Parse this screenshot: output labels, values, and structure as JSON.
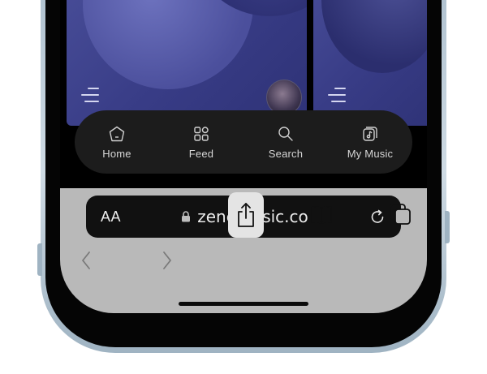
{
  "nav": {
    "items": [
      {
        "label": "Home",
        "icon": "home-icon"
      },
      {
        "label": "Feed",
        "icon": "grid-icon"
      },
      {
        "label": "Search",
        "icon": "search-icon"
      },
      {
        "label": "My Music",
        "icon": "music-note-icon"
      }
    ]
  },
  "browser": {
    "text_size_label": "AA",
    "url": "zenemusic.co",
    "lock_icon": "lock-icon",
    "reload_icon": "reload-icon"
  },
  "toolbar": {
    "buttons": [
      "back-icon",
      "forward-icon",
      "share-icon",
      "bookmarks-icon",
      "tabs-icon"
    ]
  },
  "colors": {
    "card_bg": "#3a3e88",
    "nav_bg": "#1c1c1c",
    "url_bar_bg": "#111111",
    "toolbar_bg": "#b9b9b9",
    "phone_frame": "#b8c7d3"
  }
}
